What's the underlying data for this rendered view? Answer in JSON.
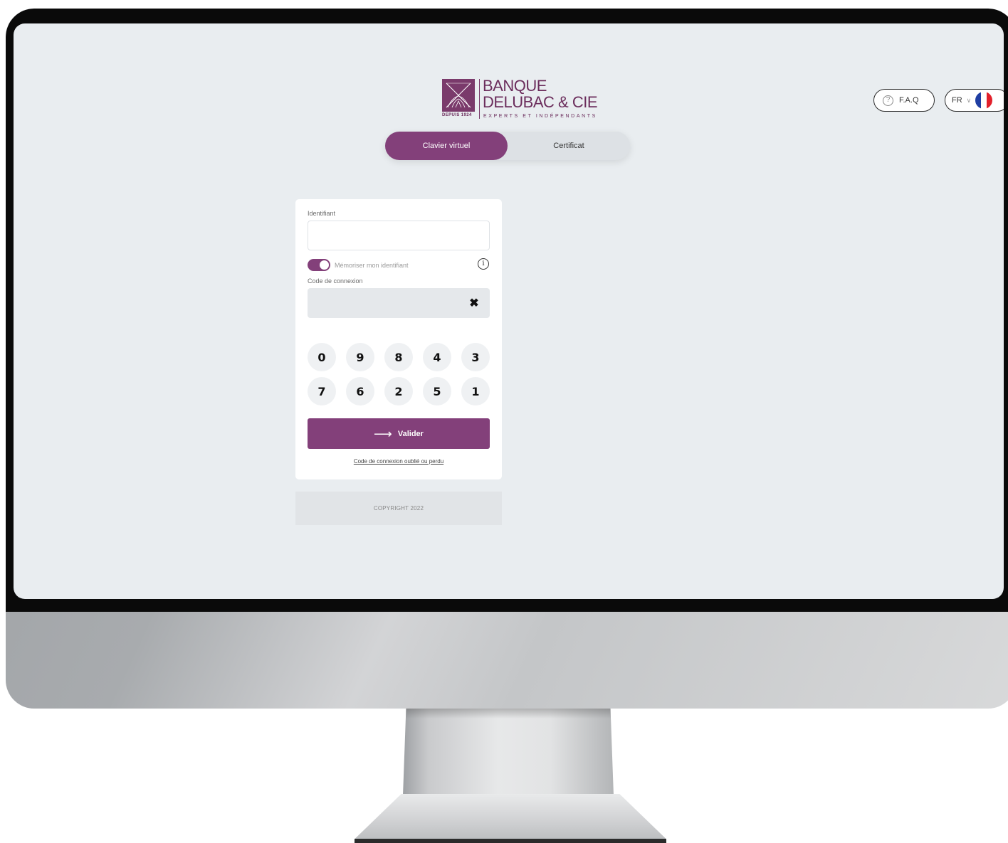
{
  "brand": {
    "line1": "BANQUE",
    "line2": "DELUBAC & CIE",
    "tagline": "EXPERTS ET INDÉPENDANTS",
    "since": "DEPUIS 1924",
    "color": "#83407a"
  },
  "header": {
    "faq_label": "F.A.Q",
    "faq_icon": "question-circle-icon",
    "language": "FR",
    "language_icon": "chevron-down-icon",
    "flag_icon": "france-flag-icon"
  },
  "tabs": [
    {
      "label": "Clavier virtuel",
      "active": true
    },
    {
      "label": "Certificat",
      "active": false
    }
  ],
  "login": {
    "identifier_label": "Identifiant",
    "identifier_value": "",
    "remember_label": "Mémoriser mon identifiant",
    "remember_enabled": true,
    "info_icon": "info-circle-icon",
    "code_label": "Code de connexion",
    "clear_glyph": "✖",
    "keypad": [
      "0",
      "9",
      "8",
      "4",
      "3",
      "7",
      "6",
      "2",
      "5",
      "1"
    ],
    "submit_label": "Valider",
    "submit_icon": "arrow-right-icon",
    "forgot_link": "Code de connexion oublié ou perdu"
  },
  "footer": {
    "copyright": "COPYRIGHT 2022"
  }
}
